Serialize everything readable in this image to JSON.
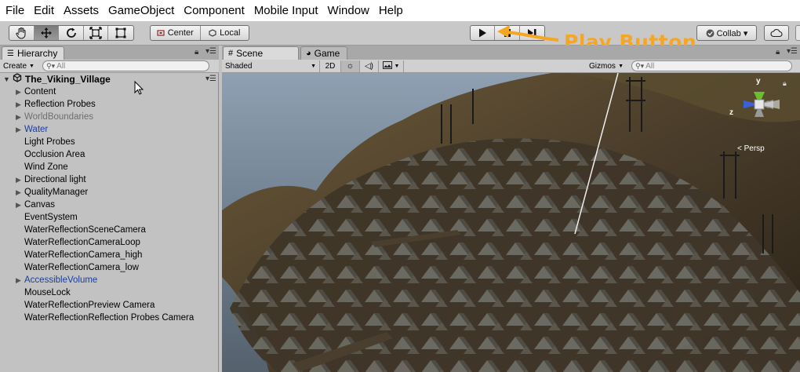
{
  "menu": [
    "File",
    "Edit",
    "Assets",
    "GameObject",
    "Component",
    "Mobile Input",
    "Window",
    "Help"
  ],
  "toolbar": {
    "tools": [
      "hand-icon",
      "move-icon",
      "rotate-icon",
      "scale-icon",
      "rect-icon"
    ],
    "pivot_center": "Center",
    "pivot_local": "Local",
    "collab": "Collab ▾",
    "annotation": "Play Button",
    "annotation_color": "#f5a623"
  },
  "hierarchy": {
    "tab": "Hierarchy",
    "create": "Create",
    "search_placeholder": "All",
    "scene_name": "The_Viking_Village",
    "items": [
      {
        "label": "Content"
      },
      {
        "label": "Reflection Probes"
      },
      {
        "label": "WorldBoundaries"
      },
      {
        "label": "Water"
      },
      {
        "label": "Light Probes"
      },
      {
        "label": "Occlusion Area"
      },
      {
        "label": "Wind Zone"
      },
      {
        "label": "Directional light"
      },
      {
        "label": "QualityManager"
      },
      {
        "label": "Canvas"
      },
      {
        "label": "EventSystem"
      },
      {
        "label": "WaterReflectionSceneCamera"
      },
      {
        "label": "WaterReflectionCameraLoop"
      },
      {
        "label": "WaterReflectionCamera_high"
      },
      {
        "label": "WaterReflectionCamera_low"
      },
      {
        "label": "AccessibleVolume"
      },
      {
        "label": "MouseLock"
      },
      {
        "label": "WaterReflectionPreview Camera"
      },
      {
        "label": "WaterReflectionReflection Probes Camera"
      }
    ]
  },
  "scene": {
    "tab_scene": "Scene",
    "tab_game": "Game",
    "shading": "Shaded",
    "mode_2d": "2D",
    "gizmos": "Gizmos",
    "search_placeholder": "All",
    "persp": "< Persp",
    "axis_y": "y",
    "axis_z": "z"
  }
}
